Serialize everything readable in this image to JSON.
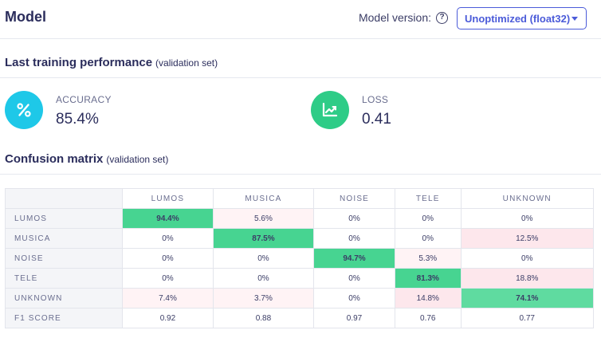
{
  "header": {
    "title": "Model",
    "version_label": "Model version:",
    "version_value": "Unoptimized (float32)"
  },
  "performance": {
    "title": "Last training performance",
    "subtitle": "(validation set)",
    "accuracy": {
      "label": "ACCURACY",
      "value": "85.4%",
      "icon": "percent-icon",
      "color": "#1ec8e8"
    },
    "loss": {
      "label": "LOSS",
      "value": "0.41",
      "icon": "trend-chart-icon",
      "color": "#2ecc87"
    }
  },
  "confusion": {
    "title": "Confusion matrix",
    "subtitle": "(validation set)",
    "columns": [
      "LUMOS",
      "MUSICA",
      "NOISE",
      "TELE",
      "UNKNOWN"
    ],
    "rows": [
      {
        "label": "LUMOS",
        "cells": [
          "94.4%",
          "5.6%",
          "0%",
          "0%",
          "0%"
        ]
      },
      {
        "label": "MUSICA",
        "cells": [
          "0%",
          "87.5%",
          "0%",
          "0%",
          "12.5%"
        ]
      },
      {
        "label": "NOISE",
        "cells": [
          "0%",
          "0%",
          "94.7%",
          "5.3%",
          "0%"
        ]
      },
      {
        "label": "TELE",
        "cells": [
          "0%",
          "0%",
          "0%",
          "81.3%",
          "18.8%"
        ]
      },
      {
        "label": "UNKNOWN",
        "cells": [
          "7.4%",
          "3.7%",
          "0%",
          "14.8%",
          "74.1%"
        ]
      }
    ],
    "f1": {
      "label": "F1 SCORE",
      "cells": [
        "0.92",
        "0.88",
        "0.97",
        "0.76",
        "0.77"
      ]
    }
  }
}
